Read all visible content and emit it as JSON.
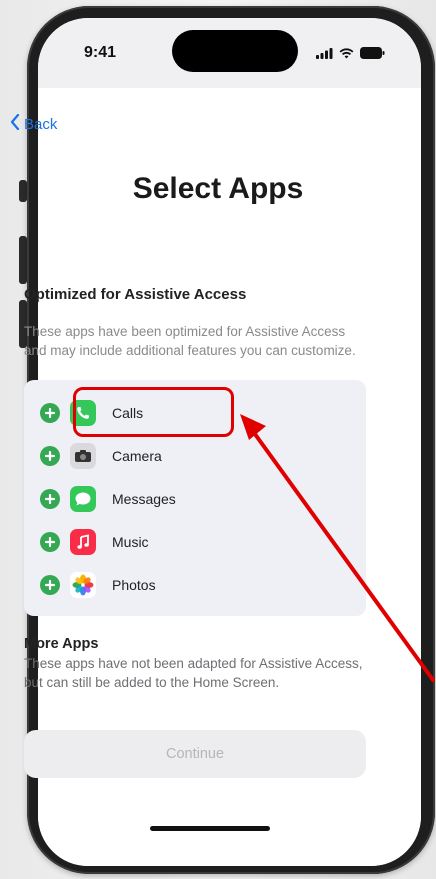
{
  "status": {
    "time": "9:41"
  },
  "nav": {
    "back_label": "Back"
  },
  "header": {
    "title": "Select Apps"
  },
  "optimized": {
    "title": "Optimized for Assistive Access",
    "description": "These apps have been optimized for Assistive Access and may include additional features you can customize."
  },
  "apps": [
    {
      "label": "Calls",
      "icon": "phone-icon",
      "color": "#34c759"
    },
    {
      "label": "Camera",
      "icon": "camera-icon",
      "color": "#d9d9de"
    },
    {
      "label": "Messages",
      "icon": "messages-icon",
      "color": "#34c759"
    },
    {
      "label": "Music",
      "icon": "music-icon",
      "color": "#fa2d48"
    },
    {
      "label": "Photos",
      "icon": "photos-icon",
      "color": "#ffffff"
    }
  ],
  "more": {
    "title": "More Apps",
    "description": "These apps have not been adapted for Assistive Access, but can still be added to the Home Screen."
  },
  "footer": {
    "continue_label": "Continue"
  },
  "annotation": {
    "highlight_color": "#e00000",
    "highlighted_item": "Calls"
  }
}
